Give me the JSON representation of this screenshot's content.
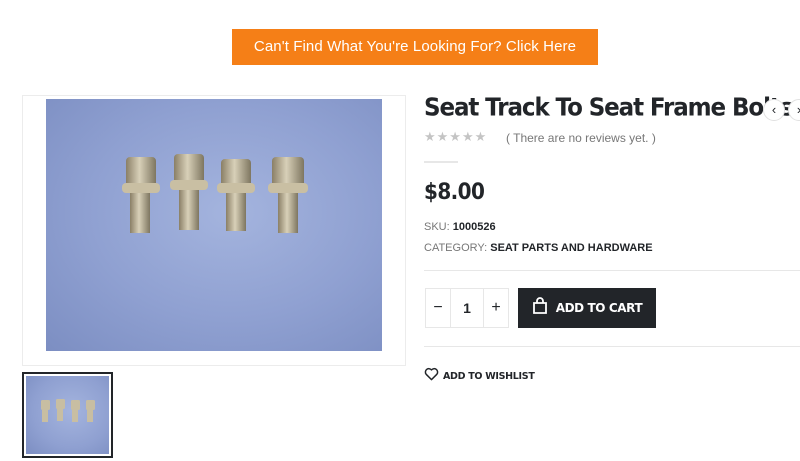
{
  "banner": {
    "cta_label": "Can't Find What You're Looking For? Click Here",
    "color": "#f57f17"
  },
  "product": {
    "title": "Seat Track To Seat Frame Bolts",
    "rating_stars": "★★★★★",
    "rating_value": 0,
    "reviews_text": "( There are no reviews yet. )",
    "price": "$8.00",
    "sku_label": "SKU:",
    "sku_value": "1000526",
    "category_label": "CATEGORY:",
    "category_value": "SEAT PARTS AND HARDWARE"
  },
  "nav": {
    "prev_icon": "‹",
    "next_icon": "›"
  },
  "cart": {
    "qty_minus": "−",
    "qty_value": "1",
    "qty_plus": "+",
    "add_label": "ADD TO CART"
  },
  "wishlist": {
    "label": "ADD TO WISHLIST"
  },
  "colors": {
    "dark": "#222529",
    "accent": "#f57f17",
    "muted": "#777777"
  },
  "icons": {
    "cart": "shopping-bag-icon",
    "wishlist": "heart-icon"
  }
}
